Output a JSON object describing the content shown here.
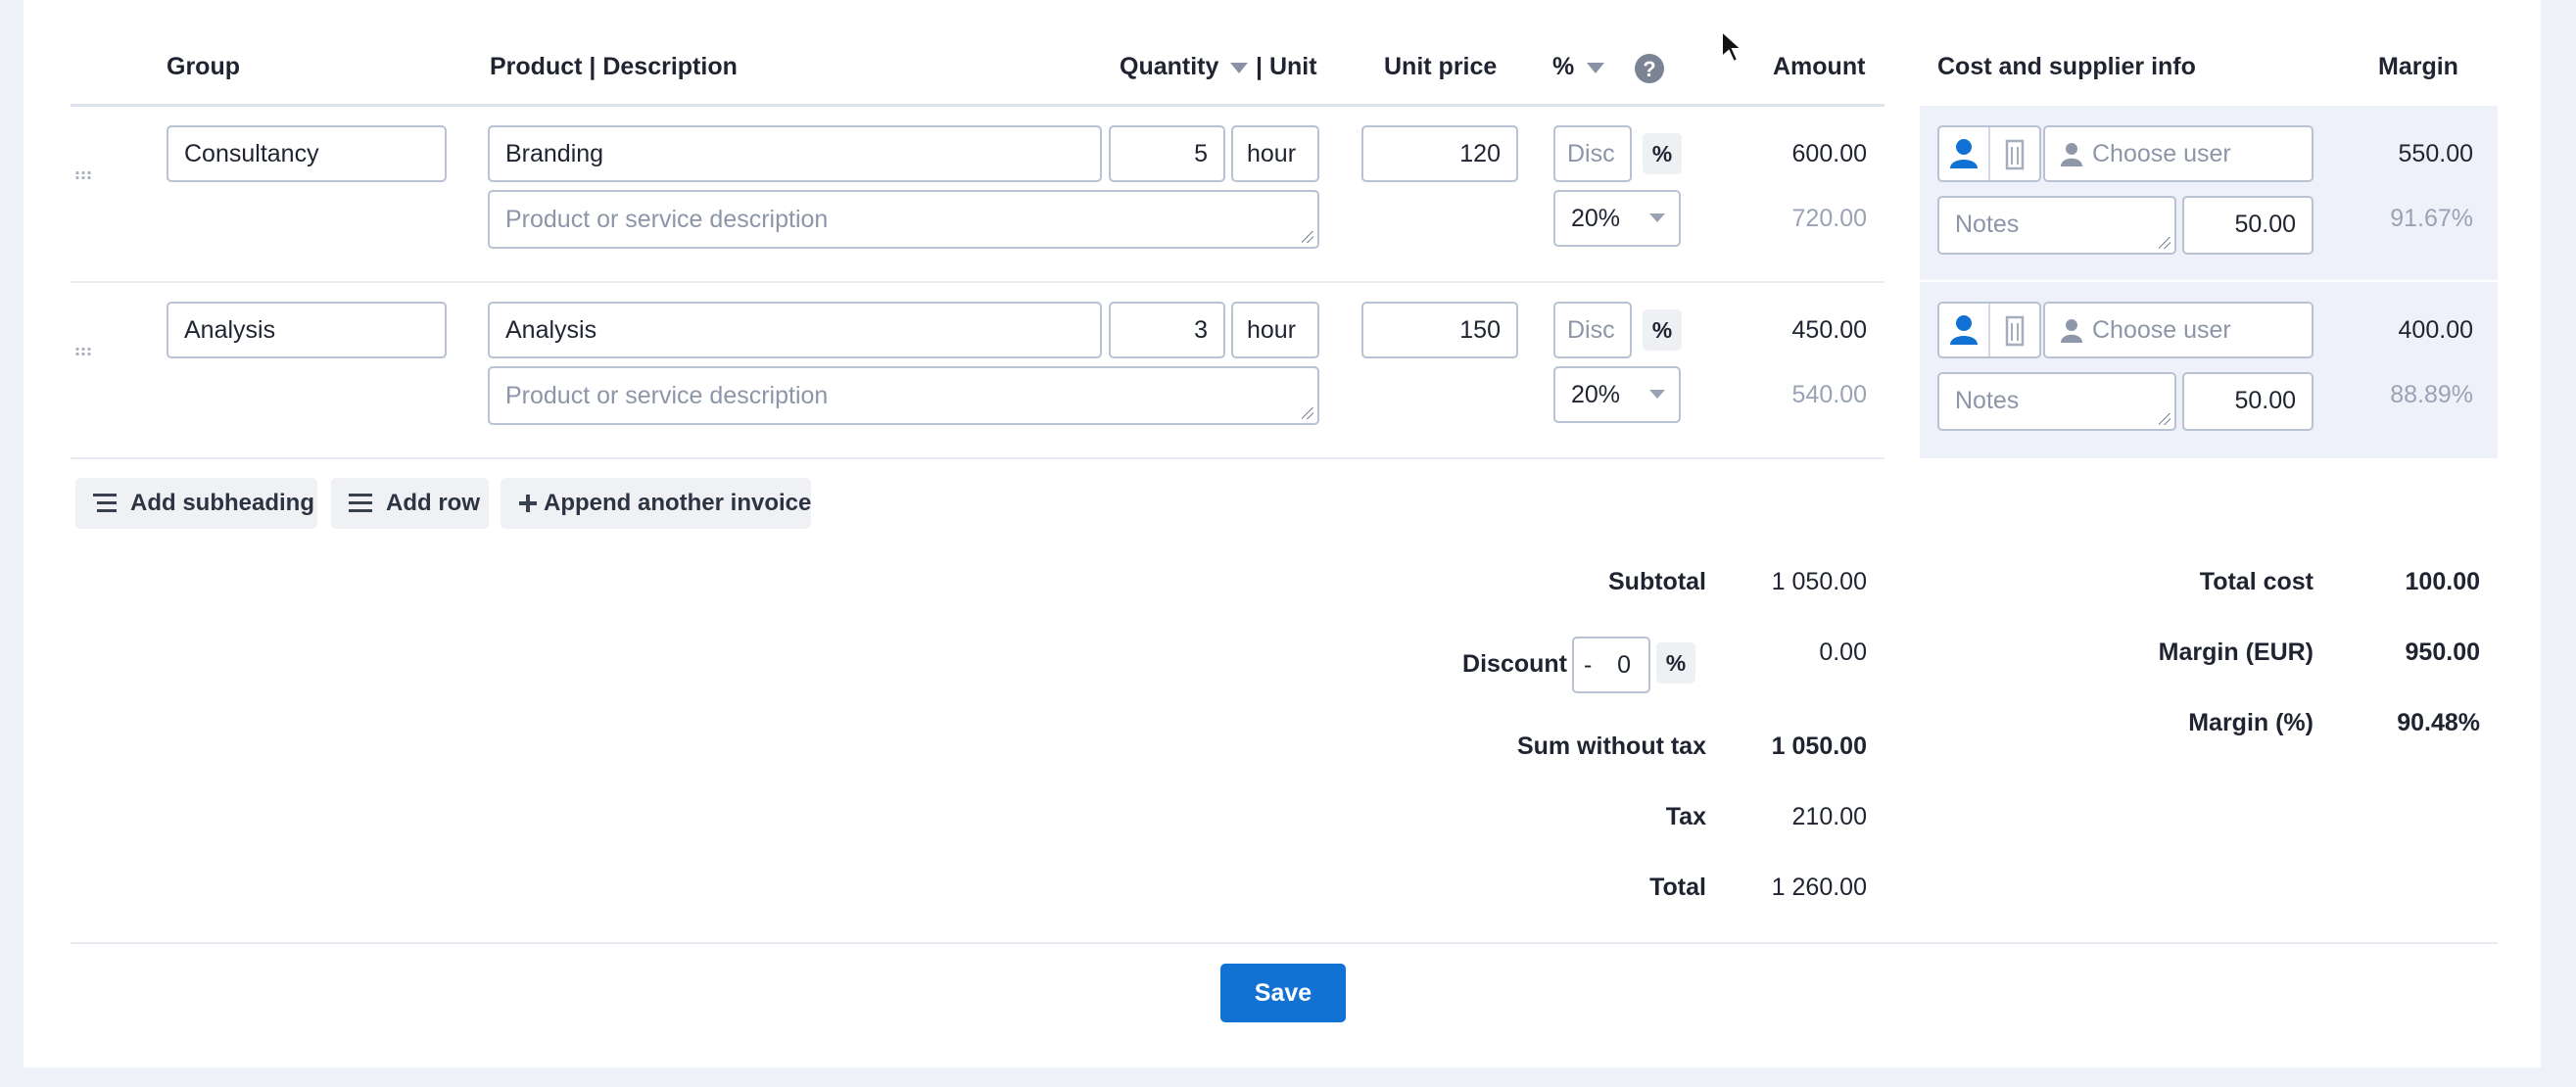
{
  "headers": {
    "group": "Group",
    "product": "Product | Description",
    "quantity": "Quantity",
    "unit": "| Unit",
    "unit_price": "Unit price",
    "percent": "%",
    "amount": "Amount",
    "cost_info": "Cost and supplier info",
    "margin": "Margin"
  },
  "rows": [
    {
      "group": "Consultancy",
      "product": "Branding",
      "description_placeholder": "Product or service description",
      "quantity": "5",
      "unit": "hour",
      "unit_price": "120",
      "discount_placeholder": "Disc",
      "discount_toggle": "%",
      "vat": "20%",
      "amount": "600.00",
      "amount_with_tax": "720.00",
      "user_placeholder": "Choose user",
      "notes_placeholder": "Notes",
      "cost": "50.00",
      "margin": "550.00",
      "margin_pct": "91.67%"
    },
    {
      "group": "Analysis",
      "product": "Analysis",
      "description_placeholder": "Product or service description",
      "quantity": "3",
      "unit": "hour",
      "unit_price": "150",
      "discount_placeholder": "Disc",
      "discount_toggle": "%",
      "vat": "20%",
      "amount": "450.00",
      "amount_with_tax": "540.00",
      "user_placeholder": "Choose user",
      "notes_placeholder": "Notes",
      "cost": "50.00",
      "margin": "400.00",
      "margin_pct": "88.89%"
    }
  ],
  "actions": {
    "add_subheading": "Add subheading",
    "add_row": "Add row",
    "append_invoice": "Append another invoice"
  },
  "totals": {
    "subtotal_label": "Subtotal",
    "subtotal": "1 050.00",
    "discount_label": "Discount",
    "discount_sign": "-",
    "discount_value": "0",
    "discount_toggle": "%",
    "discount_amount": "0.00",
    "sum_without_tax_label": "Sum without tax",
    "sum_without_tax": "1 050.00",
    "tax_label": "Tax",
    "tax": "210.00",
    "total_label": "Total",
    "total": "1 260.00"
  },
  "cost_totals": {
    "total_cost_label": "Total cost",
    "total_cost": "100.00",
    "margin_eur_label": "Margin (EUR)",
    "margin_eur": "950.00",
    "margin_pct_label": "Margin (%)",
    "margin_pct": "90.48%"
  },
  "save_label": "Save",
  "colors": {
    "accent": "#1272d4",
    "side_panel": "#eef1f9",
    "muted_text": "#9aa3b4"
  }
}
